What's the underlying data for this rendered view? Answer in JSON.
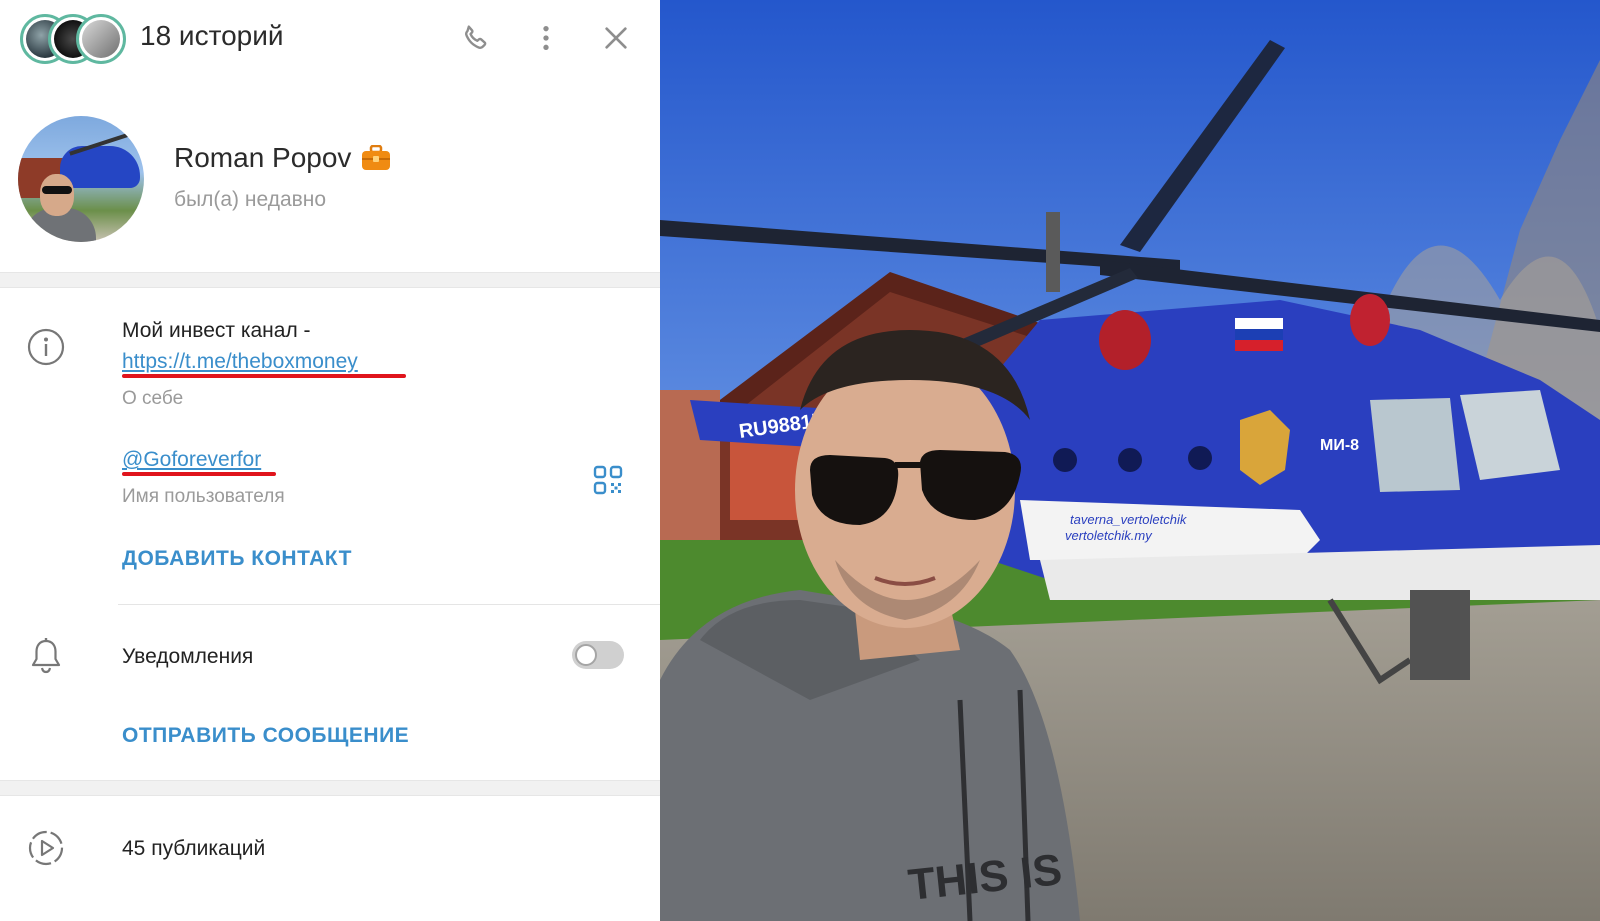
{
  "header": {
    "stories_title": "18 историй",
    "icons": [
      "phone-icon",
      "more-vertical-icon",
      "close-icon"
    ]
  },
  "profile": {
    "name": "Roman Popov",
    "name_badge_icon": "briefcase-icon",
    "status": "был(а) недавно"
  },
  "info": {
    "bio_text": "Мой инвест канал -",
    "bio_link": "https://t.me/theboxmoney",
    "bio_label": "О себе",
    "username": "@Goforeverfor",
    "username_label": "Имя пользователя",
    "add_contact": "ДОБАВИТЬ КОНТАКТ",
    "notifications_label": "Уведомления",
    "notifications_enabled": false,
    "send_message": "ОТПРАВИТЬ СООБЩЕНИЕ"
  },
  "media": {
    "publications": "45 публикаций"
  },
  "photo": {
    "registration": "RU98815608",
    "model": "МИ-8",
    "caption_line1": "taverna_vertoletchik",
    "caption_line2": "vertoletchik.my",
    "hoodie_text": "THIS IS"
  },
  "colors": {
    "accent": "#3a8ecb",
    "highlight_underline": "#e0141c",
    "secondary_text": "#9a9a9a",
    "helicopter_blue": "#2546c4"
  }
}
